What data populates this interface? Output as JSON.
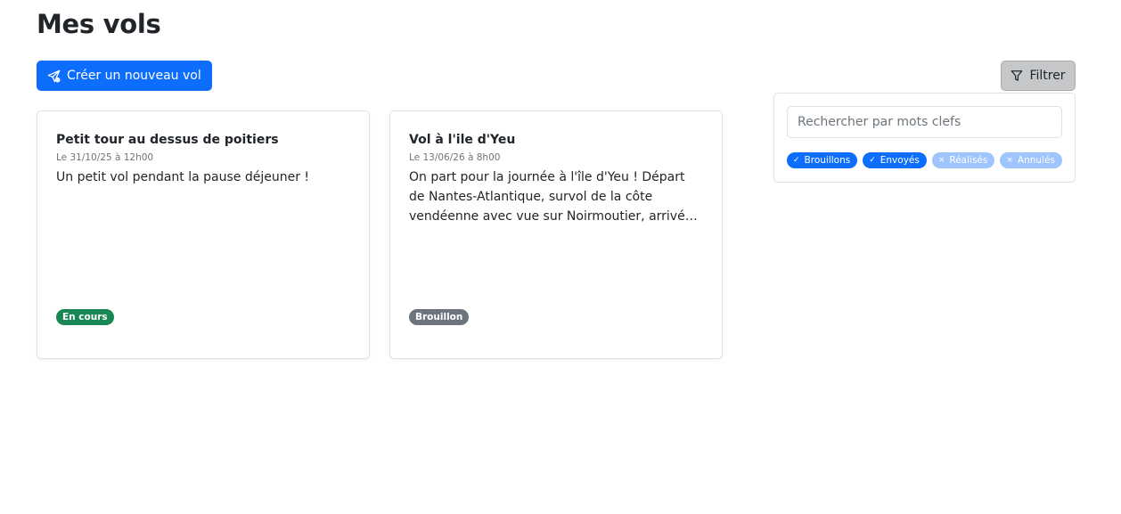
{
  "page": {
    "title": "Mes vols"
  },
  "toolbar": {
    "create_label": "Créer un nouveau vol",
    "create_icon": "paper-plane-icon",
    "filter_label": "Filtrer",
    "filter_icon": "funnel-icon"
  },
  "flights": [
    {
      "title": "Petit tour au dessus de poitiers",
      "date": "Le 31/10/25 à 12h00",
      "description": "Un petit vol pendant la pause déjeuner !",
      "status": "En cours",
      "status_color": "#198754"
    },
    {
      "title": "Vol à l'ile d'Yeu",
      "date": "Le 13/06/26 à 8h00",
      "description": "On part pour la journée à l'île d'Yeu ! Départ de Nantes-Atlantique, survol de la côte vendéenne avec vue sur Noirmoutier, arrivée à l'île d'Yeu ver...",
      "status": "Brouillon",
      "status_color": "#6c757d"
    }
  ],
  "filter": {
    "search": {
      "placeholder": "Rechercher par mots clefs",
      "value": ""
    },
    "chips": [
      {
        "label": "Brouillons",
        "selected": true,
        "mark": "✓"
      },
      {
        "label": "Envoyés",
        "selected": true,
        "mark": "✓"
      },
      {
        "label": "Réalisés",
        "selected": false,
        "mark": "×"
      },
      {
        "label": "Annulés",
        "selected": false,
        "mark": "×"
      }
    ]
  },
  "colors": {
    "primary": "#0d6efd",
    "primary_light": "#9ec5fe",
    "success": "#198754",
    "secondary": "#6c757d"
  }
}
